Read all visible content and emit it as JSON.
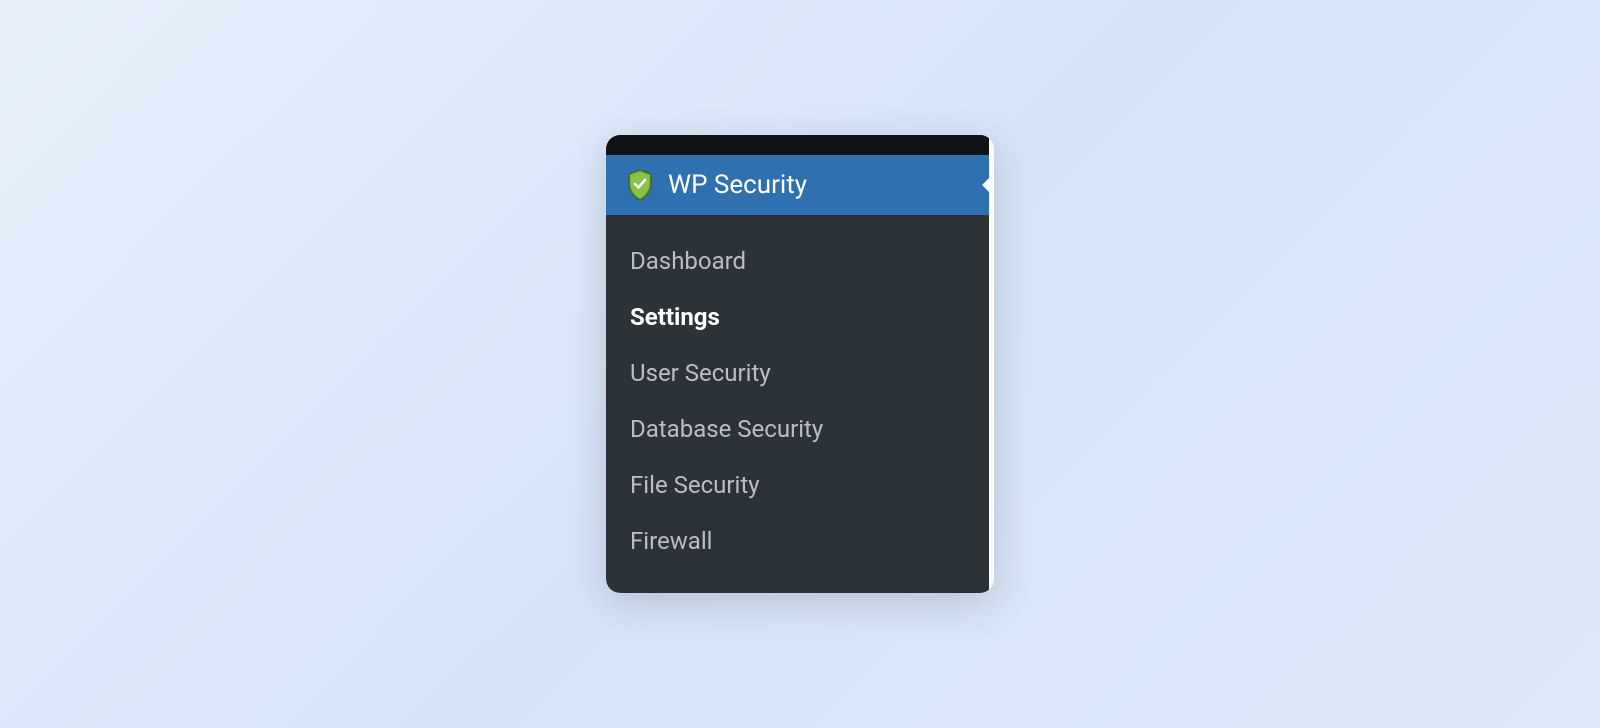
{
  "menu": {
    "header": {
      "title": "WP Security",
      "icon": "shield-check-icon"
    },
    "items": [
      {
        "label": "Dashboard",
        "active": false
      },
      {
        "label": "Settings",
        "active": true
      },
      {
        "label": "User Security",
        "active": false
      },
      {
        "label": "Database Security",
        "active": false
      },
      {
        "label": "File Security",
        "active": false
      },
      {
        "label": "Firewall",
        "active": false
      }
    ]
  }
}
